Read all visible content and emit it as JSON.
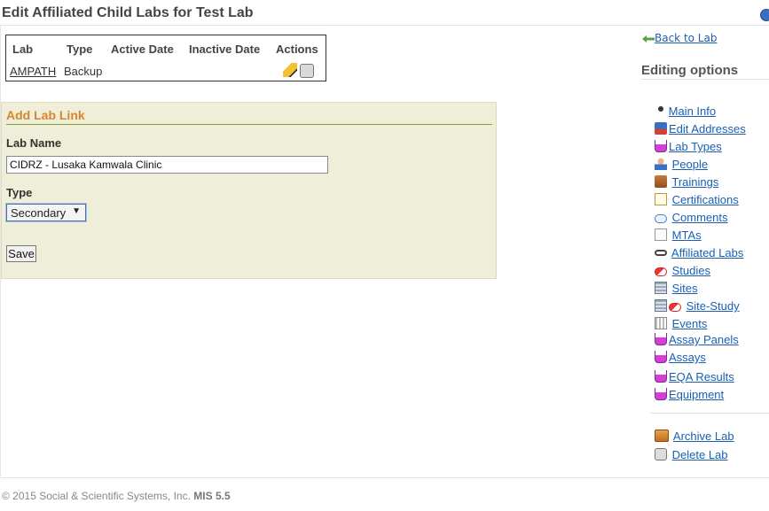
{
  "page": {
    "title": "Edit Affiliated Child Labs for Test Lab"
  },
  "affiliated_table": {
    "headers": [
      "Lab",
      "Type",
      "Active Date",
      "Inactive Date",
      "Actions"
    ],
    "rows": [
      {
        "lab": "AMPATH",
        "type": "Backup",
        "active_date": "",
        "inactive_date": "",
        "actions": [
          "pencil-icon",
          "delete-icon"
        ]
      }
    ]
  },
  "add_lab_link": {
    "title": "Add Lab Link",
    "lab_name_label": "Lab Name",
    "lab_name_value": "CIDRZ - Lusaka Kamwala Clinic",
    "type_label": "Type",
    "type_selected": "Secondary",
    "save_label": "Save"
  },
  "sidebar": {
    "back_label": "Back to Lab",
    "heading": "Editing options",
    "items": [
      {
        "label": "Main Info",
        "icon": "dot-icon"
      },
      {
        "label": "Edit Addresses",
        "icon": "truck-icon"
      },
      {
        "label": "Lab Types",
        "icon": "flask-icon"
      },
      {
        "label": "People",
        "icon": "person-icon"
      },
      {
        "label": "Trainings",
        "icon": "training-icon"
      },
      {
        "label": "Certifications",
        "icon": "certificate-icon"
      },
      {
        "label": "Comments",
        "icon": "speech-bubble-icon"
      },
      {
        "label": "MTAs",
        "icon": "document-icon"
      },
      {
        "label": "Affiliated Labs",
        "icon": "chain-link-icon"
      },
      {
        "label": "Studies",
        "icon": "pill-icon"
      },
      {
        "label": "Sites",
        "icon": "building-icon"
      },
      {
        "label": "Site-Study",
        "icon": "building-pill-icon"
      },
      {
        "label": "Events",
        "icon": "test-tubes-icon"
      },
      {
        "label": "Assay Panels",
        "icon": "flask-icon"
      },
      {
        "label": "Assays",
        "icon": "flask-icon"
      },
      {
        "label": "EQA Results",
        "icon": "flask-icon"
      },
      {
        "label": "Equipment",
        "icon": "flask-icon"
      }
    ],
    "archive_label": "Archive Lab",
    "delete_label": "Delete Lab"
  },
  "footer": {
    "copyright": "© 2015 Social & Scientific Systems, Inc.",
    "version": "MIS 5.5"
  },
  "colors": {
    "link": "#1a5fb4",
    "panel_bg": "#eeeed9",
    "panel_title": "#d7842a",
    "panel_rule": "#86a03a"
  }
}
